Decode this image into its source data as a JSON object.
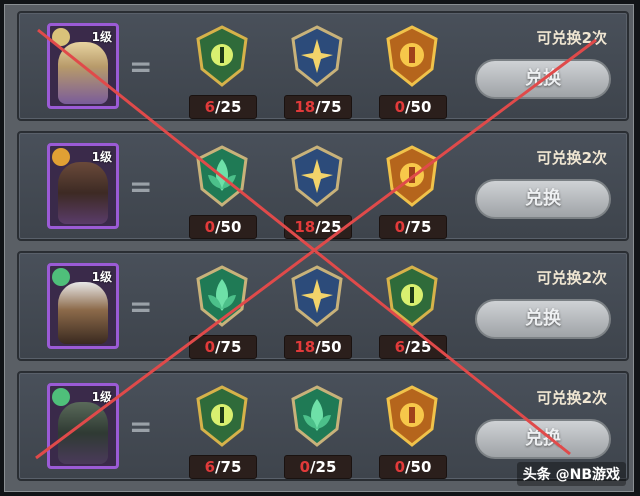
{
  "rows": [
    {
      "level": "1级",
      "portrait_theme": "purple",
      "cost": [
        {
          "icon": "green-eye-shield-icon",
          "current": "6",
          "required": "25"
        },
        {
          "icon": "blue-star-shield-icon",
          "current": "18",
          "required": "75"
        },
        {
          "icon": "gold-sun-shield-icon",
          "current": "0",
          "required": "50"
        }
      ],
      "exchange_text": "可兑换2次",
      "button_label": "兑换"
    },
    {
      "level": "1级",
      "portrait_theme": "purple",
      "cost": [
        {
          "icon": "green-leaf-shield-icon",
          "current": "0",
          "required": "50"
        },
        {
          "icon": "blue-star-shield-icon",
          "current": "18",
          "required": "25"
        },
        {
          "icon": "gold-sun-shield-icon",
          "current": "0",
          "required": "75"
        }
      ],
      "exchange_text": "可兑换2次",
      "button_label": "兑换"
    },
    {
      "level": "1级",
      "portrait_theme": "purple",
      "cost": [
        {
          "icon": "green-leaf-shield-icon",
          "current": "0",
          "required": "75"
        },
        {
          "icon": "blue-star-shield-icon",
          "current": "18",
          "required": "50"
        },
        {
          "icon": "green-eye-shield-icon",
          "current": "6",
          "required": "25"
        }
      ],
      "exchange_text": "可兑换2次",
      "button_label": "兑换"
    },
    {
      "level": "1级",
      "portrait_theme": "purple",
      "cost": [
        {
          "icon": "green-eye-shield-icon",
          "current": "6",
          "required": "75"
        },
        {
          "icon": "green-leaf-shield-icon",
          "current": "0",
          "required": "25"
        },
        {
          "icon": "gold-sun-shield-icon",
          "current": "0",
          "required": "50"
        }
      ],
      "exchange_text": "可兑换2次",
      "button_label": "兑换"
    }
  ],
  "watermark": "头条 @NB游戏",
  "colors": {
    "cross_line": "#e04a4a",
    "count_current": "#e13a3a",
    "portrait_border": "#9b5bd6"
  }
}
